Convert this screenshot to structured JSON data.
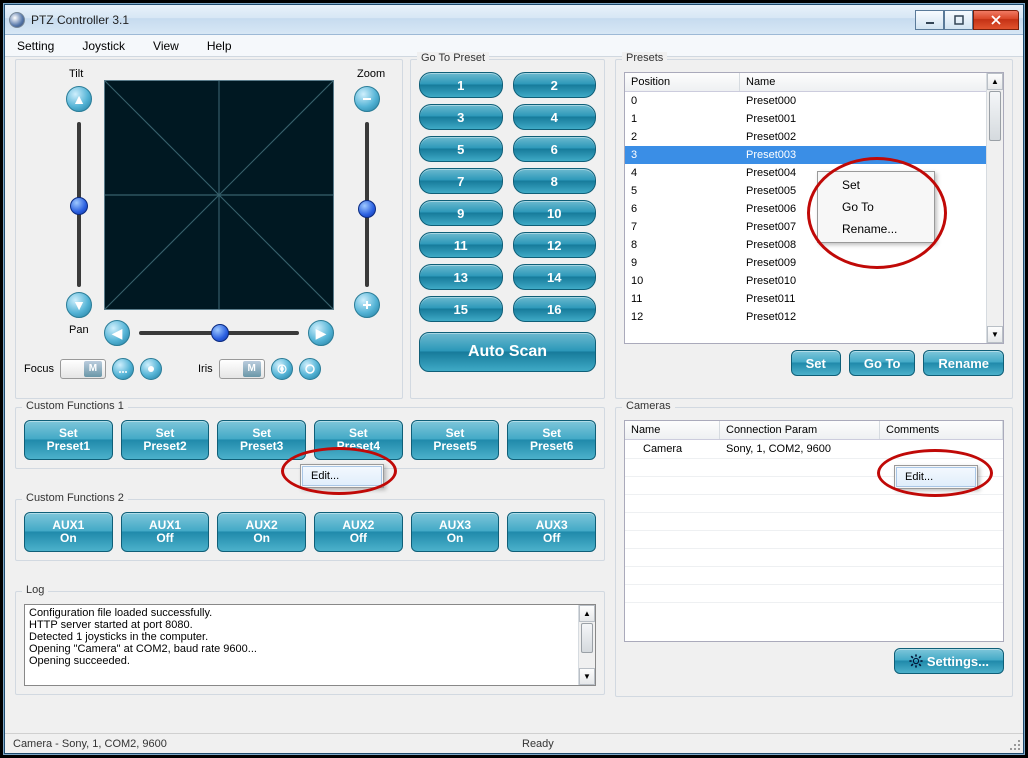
{
  "window": {
    "title": "PTZ Controller 3.1"
  },
  "menu": [
    "Setting",
    "Joystick",
    "View",
    "Help"
  ],
  "ptz": {
    "tilt_label": "Tilt",
    "zoom_label": "Zoom",
    "pan_label": "Pan",
    "focus_label": "Focus",
    "iris_label": "Iris"
  },
  "gotopreset": {
    "title": "Go To Preset",
    "buttons": [
      "1",
      "2",
      "3",
      "4",
      "5",
      "6",
      "7",
      "8",
      "9",
      "10",
      "11",
      "12",
      "13",
      "14",
      "15",
      "16"
    ],
    "autoscan": "Auto Scan"
  },
  "presets": {
    "title": "Presets",
    "col_position": "Position",
    "col_name": "Name",
    "rows": [
      {
        "pos": "0",
        "name": "Preset000"
      },
      {
        "pos": "1",
        "name": "Preset001"
      },
      {
        "pos": "2",
        "name": "Preset002"
      },
      {
        "pos": "3",
        "name": "Preset003",
        "selected": true
      },
      {
        "pos": "4",
        "name": "Preset004"
      },
      {
        "pos": "5",
        "name": "Preset005"
      },
      {
        "pos": "6",
        "name": "Preset006"
      },
      {
        "pos": "7",
        "name": "Preset007"
      },
      {
        "pos": "8",
        "name": "Preset008"
      },
      {
        "pos": "9",
        "name": "Preset009"
      },
      {
        "pos": "10",
        "name": "Preset010"
      },
      {
        "pos": "11",
        "name": "Preset011"
      },
      {
        "pos": "12",
        "name": "Preset012"
      }
    ],
    "context_menu": [
      "Set",
      "Go To",
      "Rename..."
    ],
    "btn_set": "Set",
    "btn_goto": "Go To",
    "btn_rename": "Rename"
  },
  "cf1": {
    "title": "Custom Functions 1",
    "buttons": [
      {
        "l1": "Set",
        "l2": "Preset1"
      },
      {
        "l1": "Set",
        "l2": "Preset2"
      },
      {
        "l1": "Set",
        "l2": "Preset3"
      },
      {
        "l1": "Set",
        "l2": "Preset4"
      },
      {
        "l1": "Set",
        "l2": "Preset5"
      },
      {
        "l1": "Set",
        "l2": "Preset6"
      }
    ],
    "context": "Edit..."
  },
  "cf2": {
    "title": "Custom Functions 2",
    "buttons": [
      {
        "l1": "AUX1",
        "l2": "On"
      },
      {
        "l1": "AUX1",
        "l2": "Off"
      },
      {
        "l1": "AUX2",
        "l2": "On"
      },
      {
        "l1": "AUX2",
        "l2": "Off"
      },
      {
        "l1": "AUX3",
        "l2": "On"
      },
      {
        "l1": "AUX3",
        "l2": "Off"
      }
    ]
  },
  "log": {
    "title": "Log",
    "lines": [
      "Configuration file loaded successfully.",
      "HTTP server started at port 8080.",
      "Detected 1 joysticks in the computer.",
      "Opening \"Camera\" at COM2, baud rate 9600...",
      "Opening succeeded."
    ]
  },
  "cameras": {
    "title": "Cameras",
    "col_name": "Name",
    "col_conn": "Connection Param",
    "col_comments": "Comments",
    "rows": [
      {
        "name": "Camera",
        "conn": "Sony, 1, COM2, 9600",
        "comments": ""
      }
    ],
    "context": "Edit...",
    "settings": "Settings..."
  },
  "status": {
    "left": "Camera - Sony, 1, COM2, 9600",
    "center": "Ready"
  }
}
